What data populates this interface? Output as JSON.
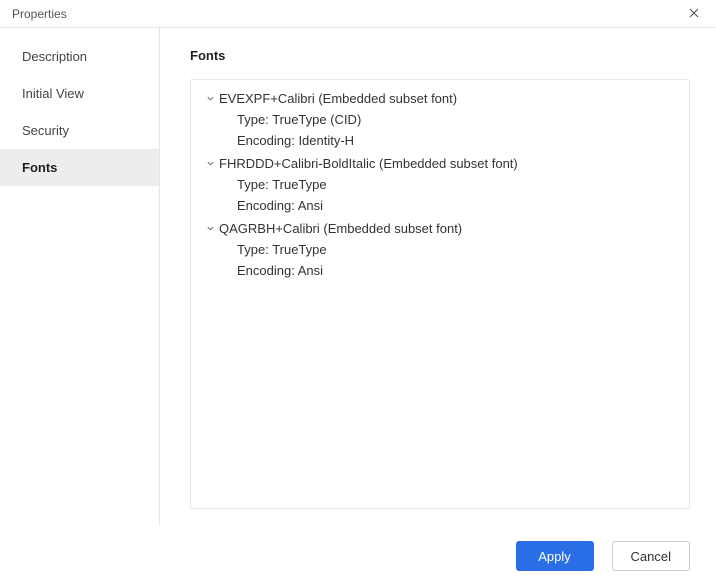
{
  "window": {
    "title": "Properties"
  },
  "sidebar": {
    "items": [
      {
        "label": "Description",
        "active": false
      },
      {
        "label": "Initial View",
        "active": false
      },
      {
        "label": "Security",
        "active": false
      },
      {
        "label": "Fonts",
        "active": true
      }
    ]
  },
  "content": {
    "section_title": "Fonts",
    "fonts": [
      {
        "name": "EVEXPF+Calibri (Embedded subset font)",
        "type_label": "Type: ",
        "type_value": "TrueType (CID)",
        "encoding_label": "Encoding: ",
        "encoding_value": "Identity-H"
      },
      {
        "name": "FHRDDD+Calibri-BoldItalic (Embedded subset font)",
        "type_label": "Type: ",
        "type_value": "TrueType",
        "encoding_label": "Encoding: ",
        "encoding_value": "Ansi"
      },
      {
        "name": "QAGRBH+Calibri (Embedded subset font)",
        "type_label": "Type: ",
        "type_value": "TrueType",
        "encoding_label": "Encoding: ",
        "encoding_value": "Ansi"
      }
    ]
  },
  "footer": {
    "apply_label": "Apply",
    "cancel_label": "Cancel"
  }
}
